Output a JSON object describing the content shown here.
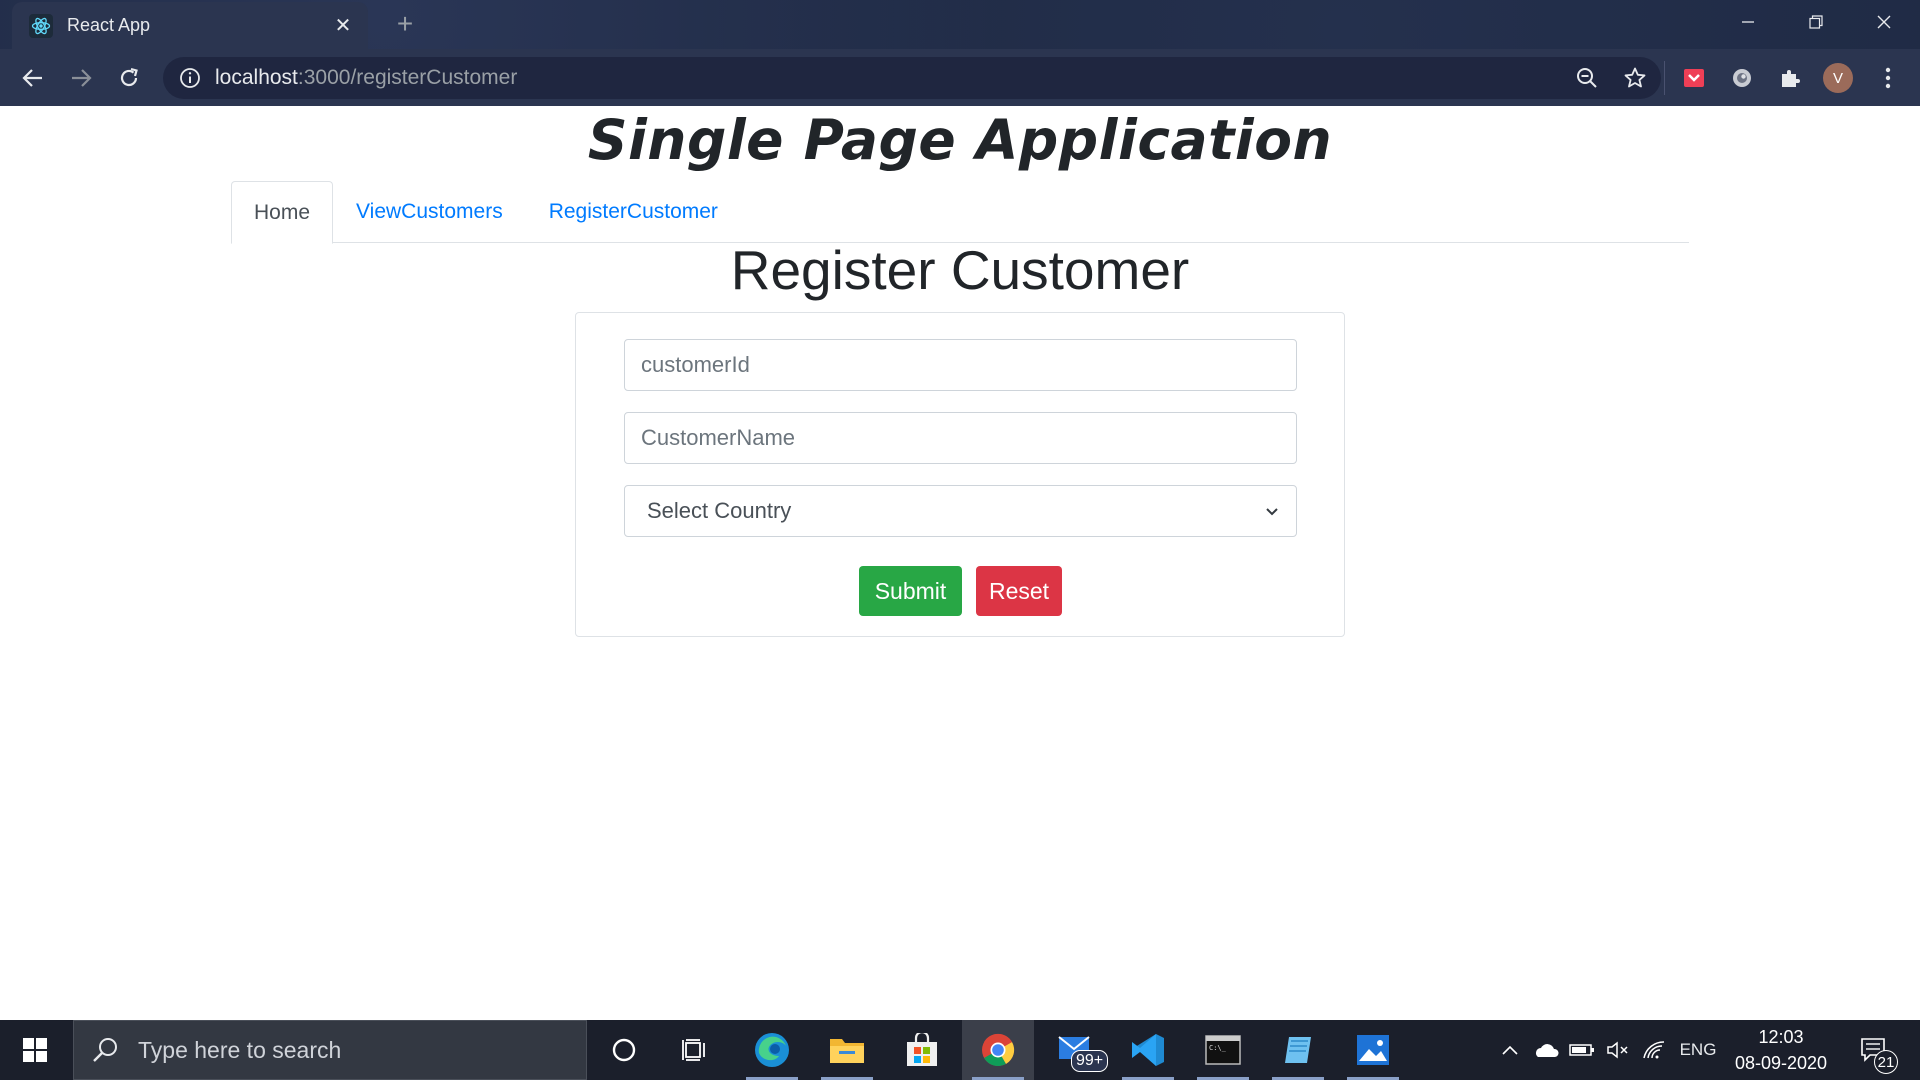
{
  "browser": {
    "tab_title": "React App",
    "url_host": "localhost",
    "url_path": ":3000/registerCustomer",
    "profile_initial": "V"
  },
  "page": {
    "app_title": "Single Page Application",
    "nav": [
      {
        "label": "Home",
        "active": true
      },
      {
        "label": "ViewCustomers",
        "active": false
      },
      {
        "label": "RegisterCustomer",
        "active": false
      }
    ],
    "heading": "Register Customer",
    "form": {
      "customer_id_placeholder": "customerId",
      "customer_name_placeholder": "CustomerName",
      "country_selected": "Select Country",
      "submit_label": "Submit",
      "reset_label": "Reset"
    }
  },
  "taskbar": {
    "search_placeholder": "Type here to search",
    "mail_badge": "99+",
    "language": "ENG",
    "time": "12:03",
    "date": "08-09-2020",
    "notification_count": "21"
  },
  "colors": {
    "primary_link": "#007bff",
    "submit": "#28a745",
    "reset": "#dc3545"
  }
}
